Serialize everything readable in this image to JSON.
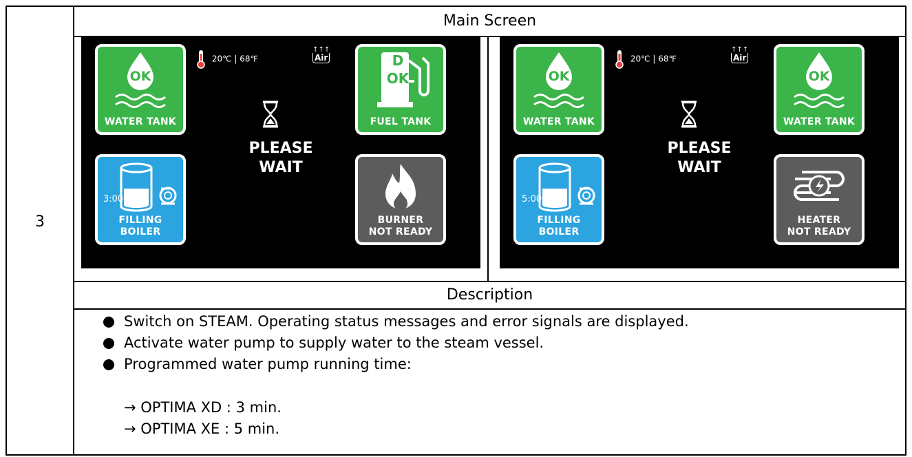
{
  "table": {
    "row_number": "3",
    "main_header": "Main Screen",
    "description_header": "Description"
  },
  "screens": [
    {
      "temperature": "20℃ |   68℉",
      "air_label": "Air",
      "wait_line1": "PLEASE",
      "wait_line2": "WAIT",
      "tiles": {
        "top_left": {
          "label": "WATER TANK",
          "badge": "OK",
          "icon": "water-drop-icon",
          "color": "#3bb44a"
        },
        "bottom_left": {
          "label_line1": "FILLING",
          "label_line2": "BOILER",
          "timer": "3:00",
          "icon": "boiler-pump-icon",
          "color": "#2ba4e0"
        },
        "top_right": {
          "label": "FUEL TANK",
          "badge_top": "D",
          "badge_bottom": "OK",
          "icon": "fuel-pump-icon",
          "color": "#3bb44a"
        },
        "bottom_right": {
          "label_line1": "BURNER",
          "label_line2": "NOT READY",
          "icon": "flame-icon",
          "color": "#5c5c5c"
        }
      }
    },
    {
      "temperature": "20℃ |   68℉",
      "air_label": "Air",
      "wait_line1": "PLEASE",
      "wait_line2": "WAIT",
      "tiles": {
        "top_left": {
          "label": "WATER TANK",
          "badge": "OK",
          "icon": "water-drop-icon",
          "color": "#3bb44a"
        },
        "bottom_left": {
          "label_line1": "FILLING",
          "label_line2": "BOILER",
          "timer": "5:00",
          "icon": "boiler-pump-icon",
          "color": "#2ba4e0"
        },
        "top_right": {
          "label": "WATER TANK",
          "badge": "OK",
          "icon": "water-drop-icon",
          "color": "#3bb44a"
        },
        "bottom_right": {
          "label_line1": "HEATER",
          "label_line2": "NOT READY",
          "icon": "heater-coil-icon",
          "color": "#5c5c5c"
        }
      }
    }
  ],
  "description": {
    "bullets": [
      "Switch on STEAM. Operating status messages and error signals are displayed.",
      "Activate water pump to supply water to the steam vessel.",
      "Programmed water pump running time:"
    ],
    "sub_items": [
      "→  OPTIMA XD : 3 min.",
      "→  OPTIMA XE : 5 min."
    ]
  }
}
